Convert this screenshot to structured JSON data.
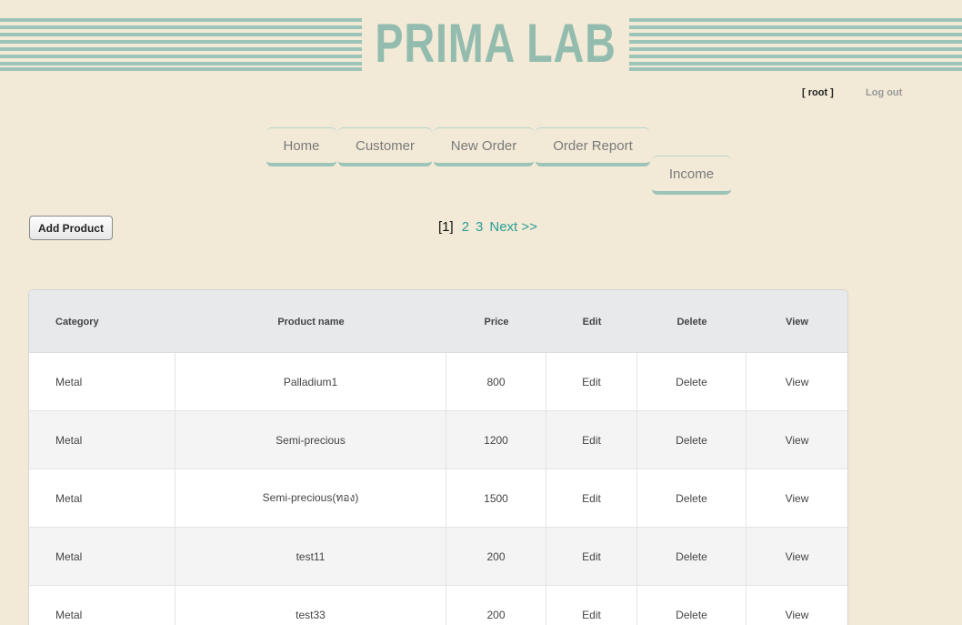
{
  "header": {
    "logo_text": "PRIMA LAB",
    "user_label": "[ root ]",
    "logout_label": "Log out"
  },
  "nav": {
    "items": [
      {
        "label": "Home"
      },
      {
        "label": "Customer"
      },
      {
        "label": "New Order"
      },
      {
        "label": "Order Report"
      },
      {
        "label": "Income"
      }
    ]
  },
  "toolbar": {
    "add_product_label": "Add Product"
  },
  "pager": {
    "current": "[1]",
    "pages": [
      "2",
      "3"
    ],
    "next_label": "Next >>"
  },
  "table": {
    "columns": [
      "Category",
      "Product name",
      "Price",
      "Edit",
      "Delete",
      "View"
    ],
    "rows": [
      {
        "category": "Metal",
        "name": "Palladium1",
        "price": "800",
        "edit": "Edit",
        "delete": "Delete",
        "view": "View"
      },
      {
        "category": "Metal",
        "name": "Semi-precious",
        "price": "1200",
        "edit": "Edit",
        "delete": "Delete",
        "view": "View"
      },
      {
        "category": "Metal",
        "name": "Semi-precious(ทอง)",
        "price": "1500",
        "edit": "Edit",
        "delete": "Delete",
        "view": "View"
      },
      {
        "category": "Metal",
        "name": "test11",
        "price": "200",
        "edit": "Edit",
        "delete": "Delete",
        "view": "View"
      },
      {
        "category": "Metal",
        "name": "test33",
        "price": "200",
        "edit": "Edit",
        "delete": "Delete",
        "view": "View"
      }
    ]
  },
  "colors": {
    "background": "#f2ead6",
    "accent": "#9cc4b8",
    "link": "#2a9d96"
  }
}
